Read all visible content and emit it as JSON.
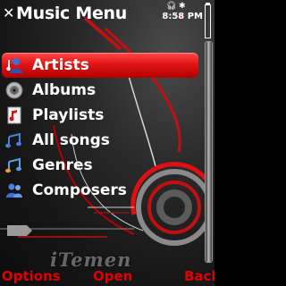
{
  "title": "Music Menu",
  "status": {
    "time": "8:58 PM",
    "icons": [
      "headphones-icon",
      "bluetooth-icon",
      "battery-icon"
    ]
  },
  "menu": {
    "selected_index": 0,
    "items": [
      {
        "label": "Artists",
        "icon": "artist-icon"
      },
      {
        "label": "Albums",
        "icon": "album-disc-icon"
      },
      {
        "label": "Playlists",
        "icon": "playlist-icon"
      },
      {
        "label": "All songs",
        "icon": "music-notes-icon"
      },
      {
        "label": "Genres",
        "icon": "genre-notes-icon"
      },
      {
        "label": "Composers",
        "icon": "composers-icon"
      }
    ]
  },
  "watermark": "iTemen",
  "softkeys": {
    "left": "Options",
    "middle": "Open",
    "right": "Back"
  },
  "colors": {
    "accent": "#e20000",
    "selection": "#d01010",
    "text": "#ffffff"
  }
}
